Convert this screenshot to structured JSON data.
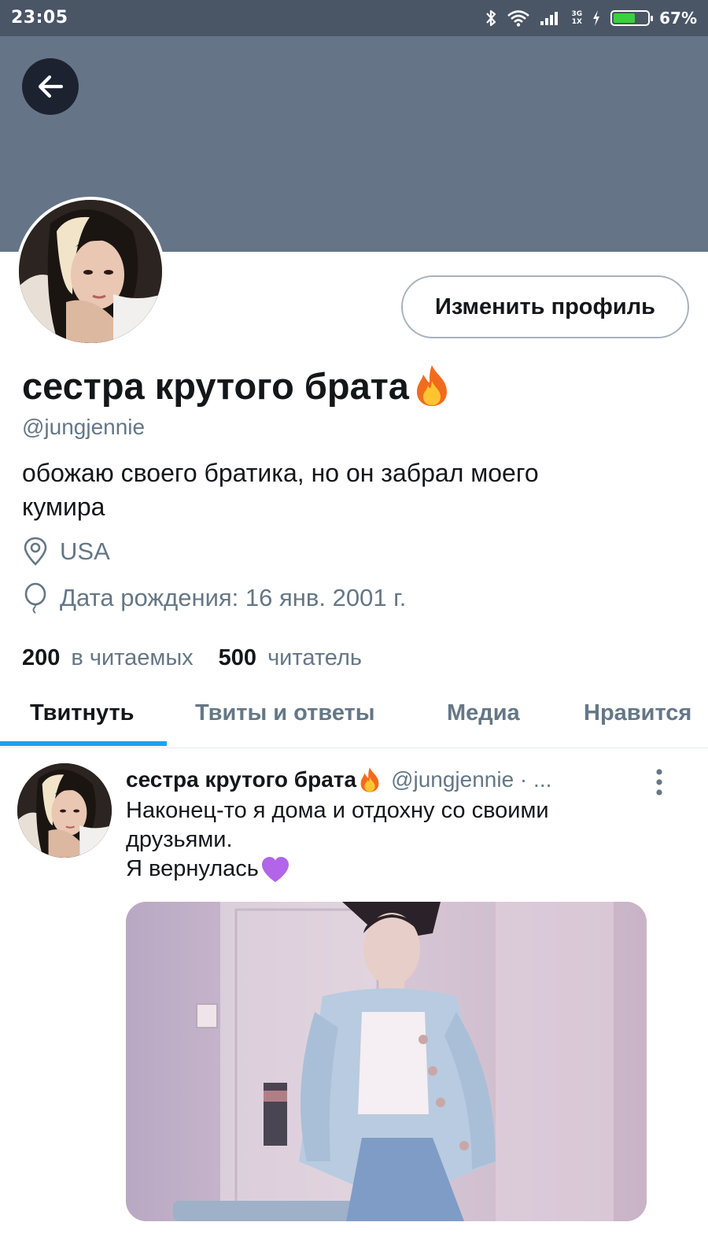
{
  "status_bar": {
    "time": "23:05",
    "network": "3G",
    "sim": "1X",
    "battery_level": 0.67,
    "battery_percent": "67%"
  },
  "header": {
    "banner_color": "#667488",
    "back_icon": "arrow-left-icon"
  },
  "profile": {
    "edit_button_label": "Изменить профиль",
    "display_name": "сестра крутого брата",
    "name_emoji_icon": "fire-icon",
    "handle": "@jungjennie",
    "bio_line1": "обожаю своего братика, но он забрал моего",
    "bio_line2": "кумира",
    "location": "USA",
    "location_icon": "location-pin-icon",
    "birthday": "Дата рождения: 16 янв. 2001 г.",
    "birthday_icon": "balloon-icon"
  },
  "stats": {
    "following_count": "200",
    "following_label": "в читаемых",
    "followers_count": "500",
    "followers_label": "читатель"
  },
  "tabs": [
    {
      "label": "Твитнуть",
      "active": true
    },
    {
      "label": "Твиты и ответы",
      "active": false
    },
    {
      "label": "Медиа",
      "active": false
    },
    {
      "label": "Нравится",
      "active": false
    }
  ],
  "accent_color": "#1da1f2",
  "tweet": {
    "author_name": "сестра крутого брата",
    "author_handle": "@jungjennie · ...",
    "line1": "Наконец-то я дома и отдохну со своими",
    "line2": "друзьями.",
    "line3": "Я вернулась",
    "line3_emoji_icon": "purple-heart-icon",
    "more_icon": "vertical-dots-icon"
  }
}
